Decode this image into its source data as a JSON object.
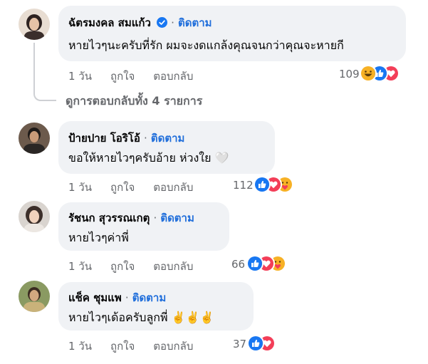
{
  "colors": {
    "link": "#216fdb",
    "like": "#1877f2",
    "love": "#f33e58",
    "haha": "#f7b125",
    "meta": "#65676b"
  },
  "labels": {
    "dot": "·",
    "follow": "ติดตาม",
    "time": "1 วัน",
    "like": "ถูกใจ",
    "reply": "ตอบกลับ"
  },
  "comments": [
    {
      "name": "ฉัตรมงคล สมแก้ว",
      "verified": true,
      "text": "หายไวๆนะครับที่รัก ผมจะงดแกล้งคุณจนกว่าคุณจะหายกี",
      "reaction_count": "109",
      "reactions": [
        "haha-icon",
        "like-icon",
        "love-icon"
      ]
    },
    {
      "name": "ป้ายปาย โอริโอ้",
      "verified": false,
      "text": "ขอให้หายไวๆครับอ้าย ห่วงใย",
      "emoji": "🤍",
      "reaction_count": "112",
      "reactions": [
        "like-icon",
        "love-icon",
        "care-icon"
      ]
    },
    {
      "name": "รัชนก สุวรรณเกตุ",
      "verified": false,
      "text": "หายไวๆค่าพี่",
      "reaction_count": "66",
      "reactions": [
        "like-icon",
        "love-icon",
        "care-icon"
      ]
    },
    {
      "name": "แช็ค ชุมแพ",
      "verified": false,
      "text": "หายไวๆเด้อครับลูกพี่",
      "emoji": "✌️✌️✌️",
      "reaction_count": "37",
      "reactions": [
        "like-icon",
        "love-icon"
      ]
    }
  ],
  "view_replies": "ดูการตอบกลับทั้ง 4 รายการ"
}
